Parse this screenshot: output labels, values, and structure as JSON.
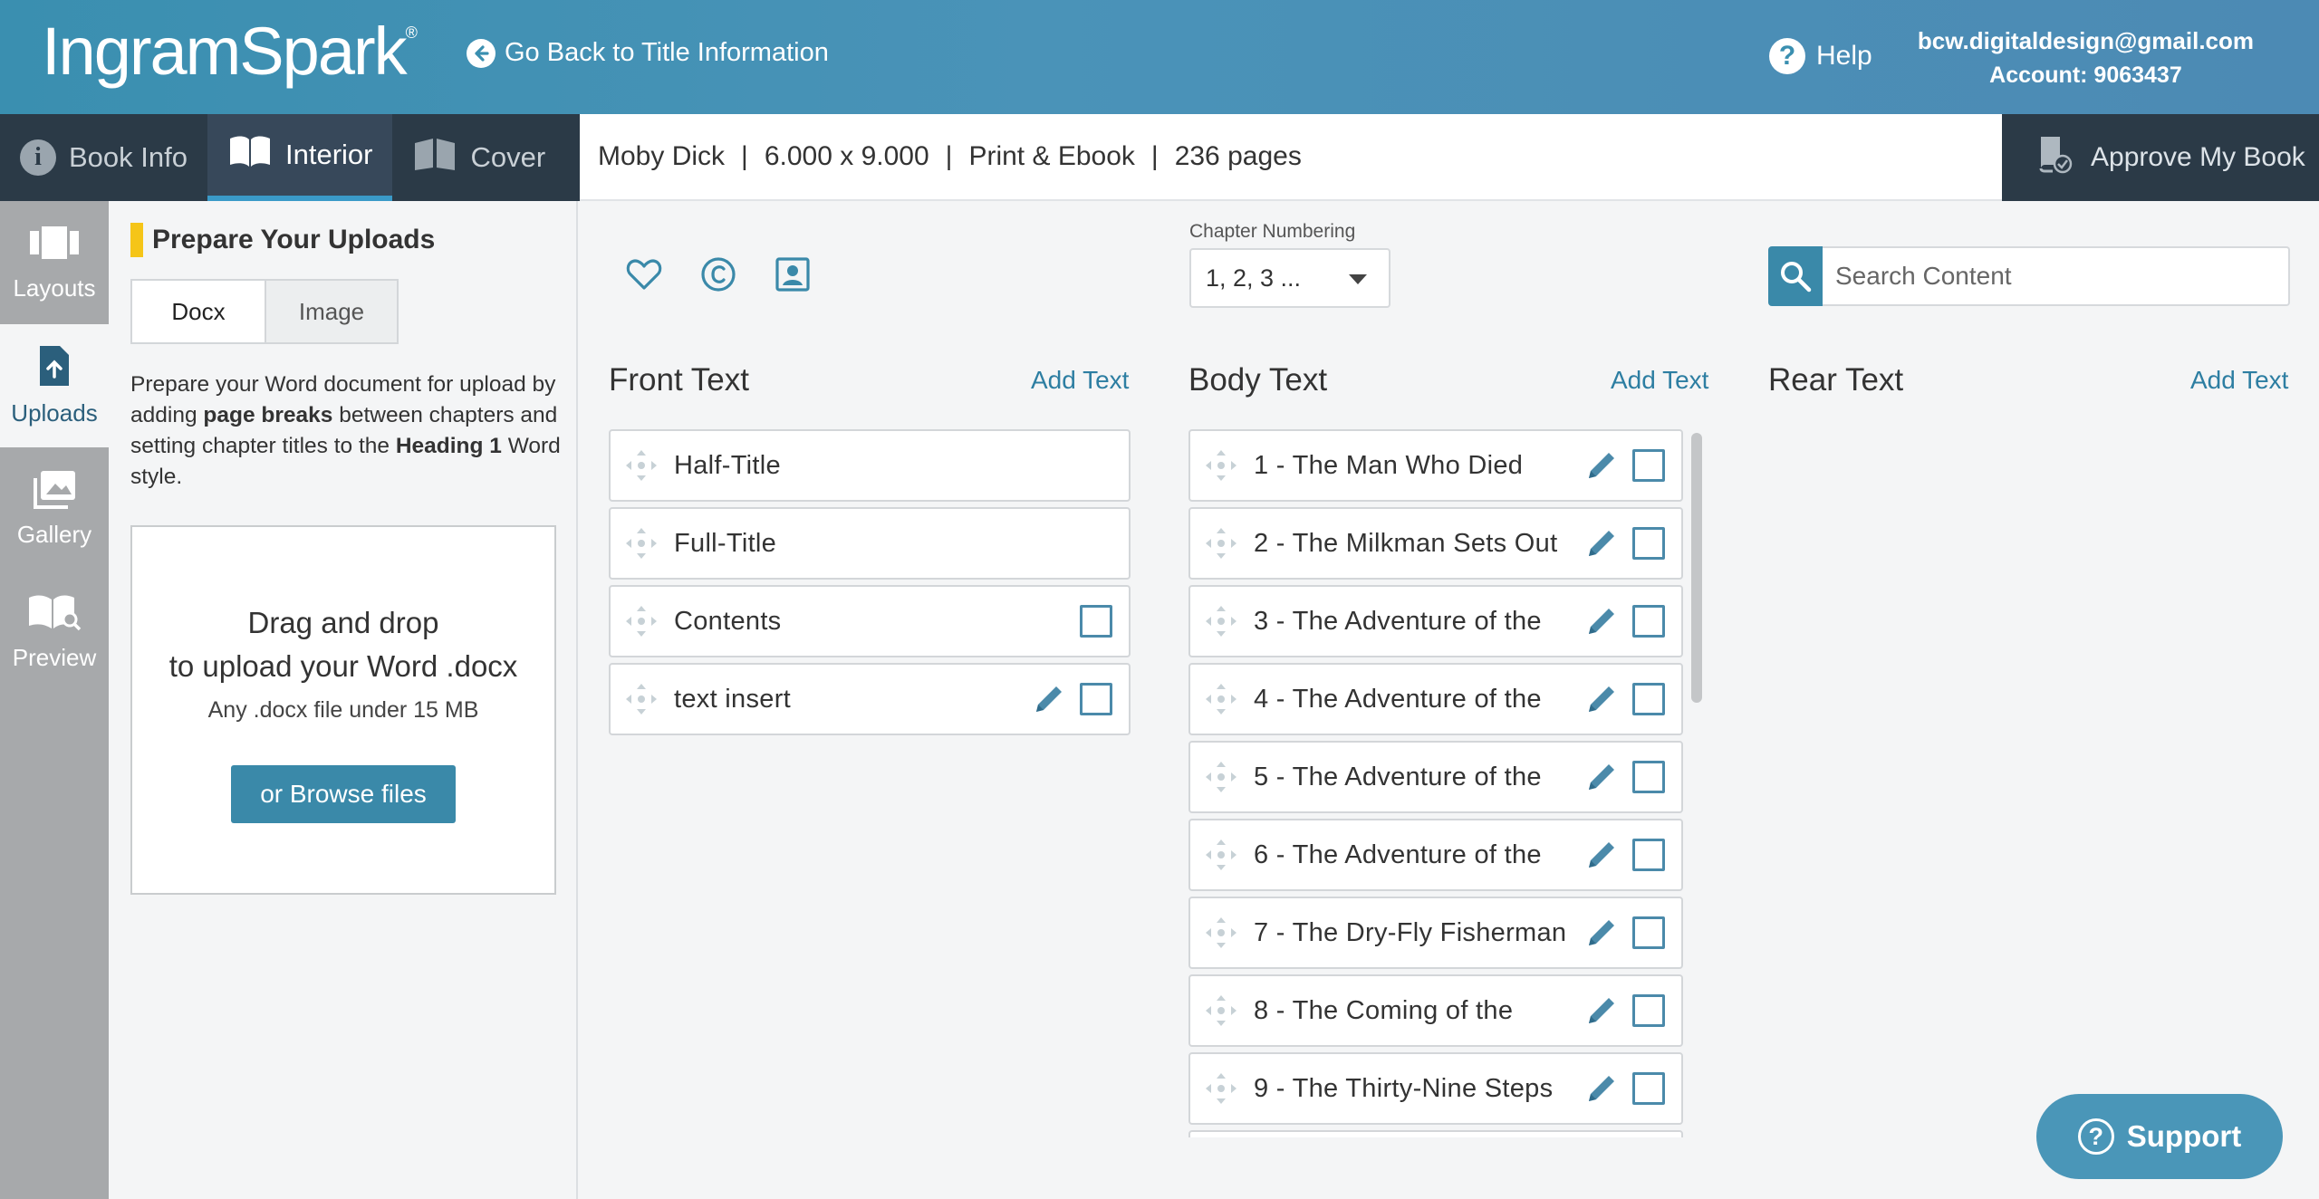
{
  "header": {
    "logo": "IngramSpark",
    "logo_mark": "®",
    "go_back": "Go Back to Title Information",
    "help": "Help",
    "email": "bcw.digitaldesign@gmail.com",
    "account": "Account: 9063437"
  },
  "tabs": [
    {
      "label": "Book Info"
    },
    {
      "label": "Interior"
    },
    {
      "label": "Cover"
    }
  ],
  "infobar": {
    "title": "Moby Dick",
    "trim": "6.000 x 9.000",
    "format": "Print & Ebook",
    "pages": "236 pages",
    "sep": "|"
  },
  "approve": "Approve My Book",
  "leftnav": [
    {
      "label": "Layouts"
    },
    {
      "label": "Uploads"
    },
    {
      "label": "Gallery"
    },
    {
      "label": "Preview"
    }
  ],
  "uploads": {
    "title": "Prepare Your Uploads",
    "seg_docx": "Docx",
    "seg_image": "Image",
    "desc_1": "Prepare your Word document for upload by adding ",
    "desc_bold_1": "page breaks",
    "desc_2": " between chapters and setting chapter titles to the ",
    "desc_bold_2": "Heading 1",
    "desc_3": " Word style.",
    "drop_line1": "Drag and drop",
    "drop_line2": "to upload your Word .docx",
    "drop_sub": "Any .docx file under 15 MB",
    "browse": "or Browse files"
  },
  "chapter_numbering": {
    "label": "Chapter Numbering",
    "value": "1, 2, 3 ..."
  },
  "search": {
    "placeholder": "Search Content"
  },
  "front": {
    "title": "Front Text",
    "add": "Add Text",
    "items": [
      "Half-Title",
      "Full-Title",
      "Contents",
      "text insert"
    ]
  },
  "body": {
    "title": "Body Text",
    "add": "Add Text",
    "items": [
      "1 - The Man Who Died",
      "2 - The Milkman Sets Out",
      "3 - The Adventure of the",
      "4 - The Adventure of the",
      "5 - The Adventure of the",
      "6 - The Adventure of the",
      "7 - The Dry-Fly Fisherman",
      "8 - The Coming of the",
      "9 - The Thirty-Nine Steps"
    ]
  },
  "rear": {
    "title": "Rear Text",
    "add": "Add Text"
  },
  "support": "Support",
  "colors": {
    "brand": "#3a8fb0",
    "nav_dark": "#2b3a47",
    "accent_yellow": "#f5c518",
    "link": "#2d7ea2"
  }
}
